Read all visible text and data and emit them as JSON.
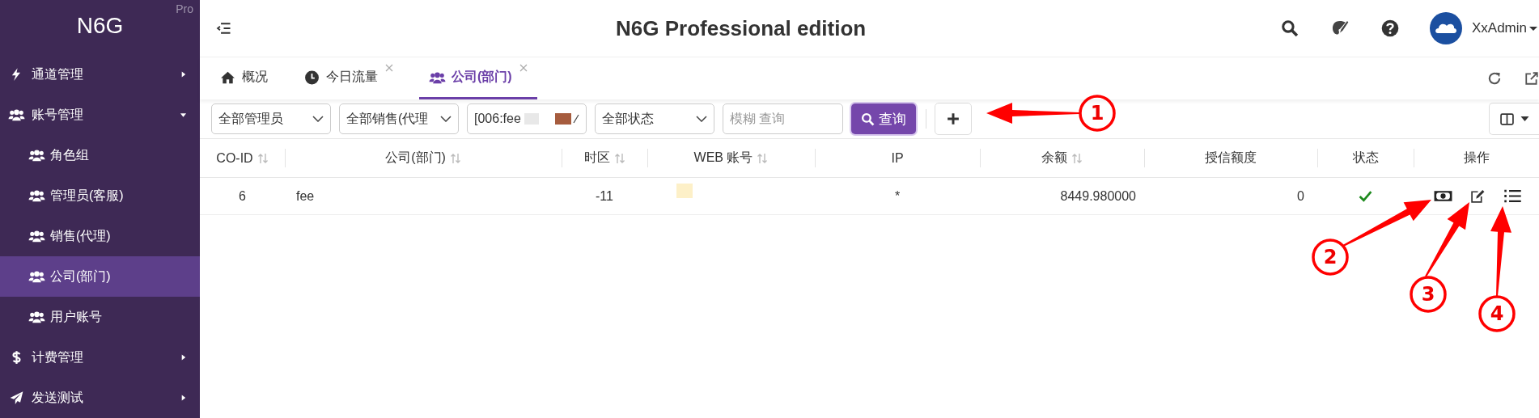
{
  "sidebar": {
    "logo": "N6G",
    "edition_badge": "Pro",
    "items": [
      {
        "label": "通道管理",
        "kind": "bolt",
        "expanded": false,
        "selected": false
      },
      {
        "label": "账号管理",
        "kind": "users",
        "expanded": true,
        "selected": false,
        "children": [
          {
            "label": "角色组",
            "selected": false
          },
          {
            "label": "管理员(客服)",
            "selected": false
          },
          {
            "label": "销售(代理)",
            "selected": false
          },
          {
            "label": "公司(部门)",
            "selected": true
          },
          {
            "label": "用户账号",
            "selected": false
          }
        ]
      },
      {
        "label": "计费管理",
        "kind": "dollar",
        "expanded": false,
        "selected": false
      },
      {
        "label": "发送测试",
        "kind": "plane",
        "expanded": false,
        "selected": false
      }
    ]
  },
  "header": {
    "title": "N6G Professional edition",
    "user": "XxAdmin"
  },
  "tabs": [
    {
      "label": "概况",
      "kind": "home",
      "closable": false,
      "selected": false
    },
    {
      "label": "今日流量",
      "kind": "clock",
      "closable": true,
      "selected": false
    },
    {
      "label": "公司(部门)",
      "kind": "users",
      "closable": true,
      "selected": true
    }
  ],
  "filters": [
    {
      "kind": "select",
      "value": "全部管理员"
    },
    {
      "kind": "select",
      "value": "全部销售(代理"
    },
    {
      "kind": "combo",
      "value": "[006:fee"
    },
    {
      "kind": "select",
      "value": "全部状态"
    },
    {
      "kind": "search",
      "placeholder": "模糊 查询"
    }
  ],
  "search_button": "查询",
  "table": {
    "columns": [
      {
        "label": "CO-ID",
        "sortable": true
      },
      {
        "label": "公司(部门)",
        "sortable": true
      },
      {
        "label": "时区",
        "sortable": true
      },
      {
        "label": "WEB 账号",
        "sortable": true
      },
      {
        "label": "IP",
        "sortable": false
      },
      {
        "label": "余额",
        "sortable": true
      },
      {
        "label": "授信额度",
        "sortable": false
      },
      {
        "label": "状态",
        "sortable": false
      },
      {
        "label": "操作",
        "sortable": false
      }
    ],
    "rows": [
      {
        "co_id": "6",
        "company": "fee",
        "timezone": "-11",
        "ip": "*",
        "balance": "8449.980000",
        "credit": "0",
        "active": true
      }
    ]
  },
  "annotations": [
    {
      "label": "1"
    },
    {
      "label": "2"
    },
    {
      "label": "3"
    },
    {
      "label": "4"
    }
  ]
}
